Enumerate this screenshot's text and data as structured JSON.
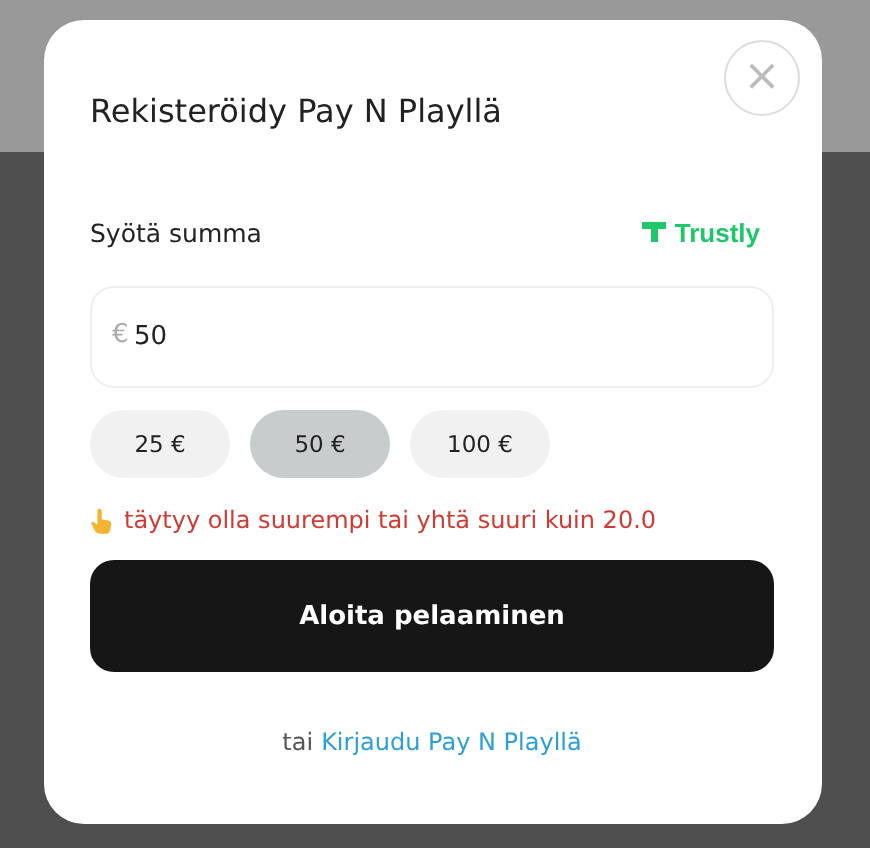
{
  "dialog": {
    "title": "Rekisteröidy Pay N Playllä",
    "close_label": "×"
  },
  "amount": {
    "label": "Syötä summa",
    "provider": "Trustly",
    "currency": "€",
    "value": "50"
  },
  "presets": [
    {
      "label": "25 €",
      "selected": false
    },
    {
      "label": "50 €",
      "selected": true
    },
    {
      "label": "100 €",
      "selected": false
    }
  ],
  "error": "täytyy olla suurempi tai yhtä suuri kuin 20.0",
  "submit": "Aloita pelaaminen",
  "footer": {
    "prefix": "tai",
    "link": "Kirjaudu Pay N Playllä"
  }
}
